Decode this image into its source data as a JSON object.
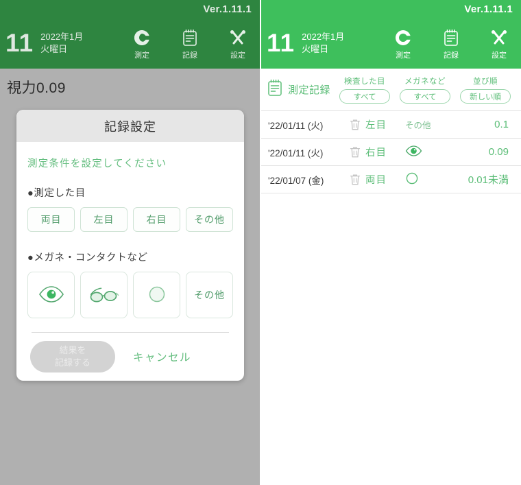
{
  "header": {
    "version": "Ver.1.11.1",
    "day": "11",
    "month_line": "2022年1月",
    "weekday_line": "火曜日",
    "nav": [
      {
        "label": "測定",
        "icon": "landolt-c-icon"
      },
      {
        "label": "記録",
        "icon": "notepad-icon"
      },
      {
        "label": "設定",
        "icon": "tools-icon"
      }
    ]
  },
  "left": {
    "vision_text": "視力0.09",
    "dialog": {
      "title": "記録設定",
      "note": "測定条件を設定してください",
      "eye_section_label": "●測定した目",
      "eye_options": [
        "両目",
        "左目",
        "右目",
        "その他"
      ],
      "glasses_section_label": "●メガネ・コンタクトなど",
      "glasses_options": [
        {
          "label": "",
          "icon": "naked-eye-icon"
        },
        {
          "label": "",
          "icon": "glasses-icon"
        },
        {
          "label": "",
          "icon": "contact-lens-icon"
        },
        {
          "label": "その他",
          "icon": "text-other"
        }
      ],
      "save_line1": "結果を",
      "save_line2": "記録する",
      "cancel_label": "キャンセル"
    }
  },
  "right": {
    "filter": {
      "title": "測定記録",
      "groups": [
        {
          "caption": "検査した目",
          "value": "すべて"
        },
        {
          "caption": "メガネなど",
          "value": "すべて"
        },
        {
          "caption": "並び順",
          "value": "新しい順"
        }
      ]
    },
    "records": [
      {
        "date": "'22/01/11 (火)",
        "eye": "左目",
        "condition_label": "その他",
        "condition_icon": "text",
        "value": "0.1"
      },
      {
        "date": "'22/01/11 (火)",
        "eye": "右目",
        "condition_label": "",
        "condition_icon": "naked-eye-icon",
        "value": "0.09"
      },
      {
        "date": "'22/01/07 (金)",
        "eye": "両目",
        "condition_label": "",
        "condition_icon": "contact-lens-icon",
        "value": "0.01未満"
      }
    ]
  },
  "colors": {
    "brand_green": "#3ebf5c",
    "dim_green": "#2e8540",
    "text_green": "#5bbd77",
    "overlay_gray": "#b0b0b0"
  }
}
